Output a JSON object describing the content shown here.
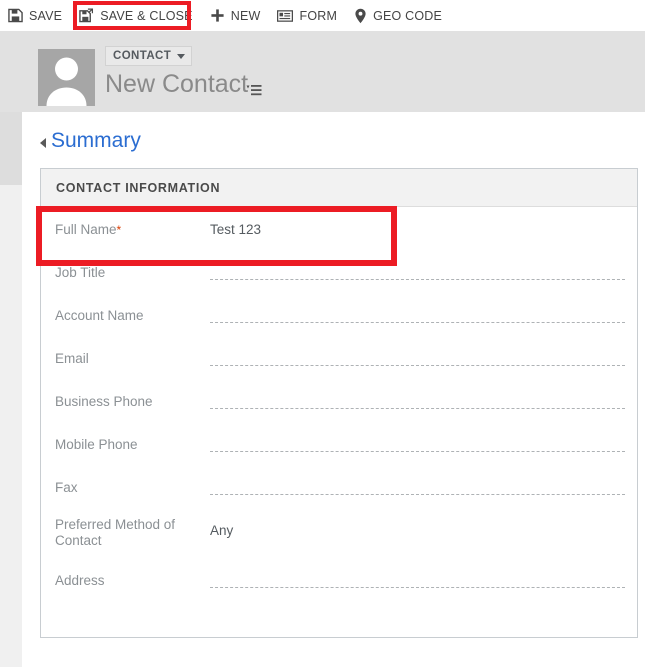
{
  "command_bar": {
    "buttons": [
      {
        "label": "SAVE",
        "icon": "floppy-disk-icon",
        "name": "save"
      },
      {
        "label": "SAVE & CLOSE",
        "icon": "floppy-disk-arrow-icon",
        "name": "save-and-close",
        "highlighted": true
      },
      {
        "label": "NEW",
        "icon": "plus-icon",
        "name": "new"
      },
      {
        "label": "FORM",
        "icon": "form-card-icon",
        "name": "form"
      },
      {
        "label": "GEO CODE",
        "icon": "map-pin-icon",
        "name": "geo-code"
      }
    ]
  },
  "header": {
    "entity_type": "CONTACT",
    "record_title": "New Contact",
    "avatar_icon": "person-placeholder-icon",
    "title_menu_icon": "record-set-menu-icon"
  },
  "tabs": [
    {
      "label": "Summary",
      "expanded": true
    }
  ],
  "section": {
    "title": "CONTACT INFORMATION",
    "fields": [
      {
        "label": "Full Name",
        "required": true,
        "value": "Test 123",
        "empty": false,
        "highlighted": true
      },
      {
        "label": "Job Title",
        "required": false,
        "value": "",
        "empty": true
      },
      {
        "label": "Account Name",
        "required": false,
        "value": "",
        "empty": true
      },
      {
        "label": "Email",
        "required": false,
        "value": "",
        "empty": true
      },
      {
        "label": "Business Phone",
        "required": false,
        "value": "",
        "empty": true
      },
      {
        "label": "Mobile Phone",
        "required": false,
        "value": "",
        "empty": true
      },
      {
        "label": "Fax",
        "required": false,
        "value": "",
        "empty": true
      },
      {
        "label": "Preferred Method of Contact",
        "required": false,
        "value": "Any",
        "empty": false,
        "tall": true
      },
      {
        "label": "Address",
        "required": false,
        "value": "",
        "empty": true
      }
    ]
  },
  "colors": {
    "highlight_red": "#ec1c24",
    "tab_blue": "#2b6dd1",
    "header_band": "#e1e1e1",
    "label_gray": "#8b9094",
    "required_asterisk": "#d83b01"
  }
}
